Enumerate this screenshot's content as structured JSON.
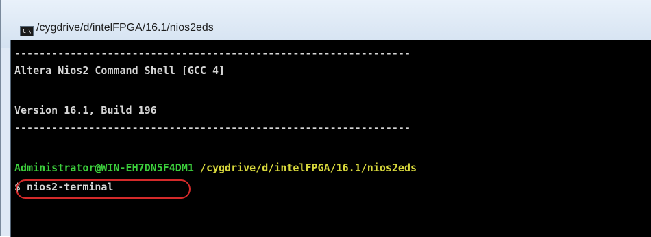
{
  "window": {
    "title": "/cygdrive/d/intelFPGA/16.1/nios2eds",
    "icon": "console-icon",
    "icon_text": "C:\\"
  },
  "console": {
    "separator_1": "----------------------------------------------------------------",
    "line_header": "Altera Nios2 Command Shell [GCC 4]",
    "line_version": "Version 16.1, Build 196",
    "separator_2": "----------------------------------------------------------------",
    "prompt_user": "Administrator@WIN-EH7DN5F4DM1",
    "prompt_path": " /cygdrive/d/intelFPGA/16.1/nios2eds",
    "command": "$ nios2-terminal"
  },
  "colors": {
    "prompt_user": "#3ccf3c",
    "prompt_path": "#d8d83c",
    "text": "#d6d6d6",
    "highlight_circle": "#d42a2a"
  }
}
